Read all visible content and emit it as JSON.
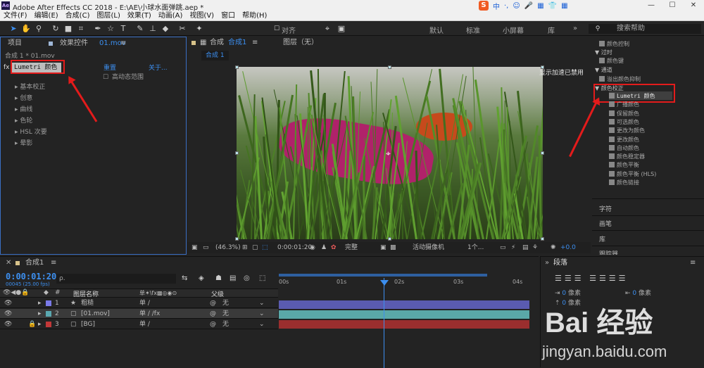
{
  "window": {
    "title": "Adobe After Effects CC 2018 - E:\\AE\\小球水面弹跳.aep *",
    "logo": "Ae",
    "controls": [
      "—",
      "☐",
      "✕"
    ]
  },
  "ime": {
    "brand": "S",
    "mode": "中",
    "icons": [
      "·,",
      "☺",
      "🎤",
      "▦",
      "👕",
      "▦"
    ]
  },
  "menu": [
    "文件(F)",
    "编辑(E)",
    "合成(C)",
    "图层(L)",
    "效果(T)",
    "动画(A)",
    "视图(V)",
    "窗口",
    "帮助(H)"
  ],
  "toolbar": {
    "snap_label": "对齐",
    "workspaces": [
      "默认",
      "标准",
      "小屏幕",
      "库"
    ],
    "more": "»",
    "search_placeholder": "搜索帮助"
  },
  "left_panel": {
    "tab_project": "项目",
    "tab_effects": "效果控件",
    "tab_effects_file": "01.mov",
    "menu": "≡",
    "breadcrumb": "合成 1 * 01.mov",
    "effect_fx": "fx",
    "effect_name": "Lumetri 颜色",
    "reset": "重置",
    "about": "关于...",
    "checkbox_label": "高动态范围",
    "sections": [
      "基本校正",
      "创意",
      "曲线",
      "色轮",
      "HSL 次要",
      "晕影"
    ]
  },
  "viewer": {
    "tab_comp": "合成",
    "tab_comp_name": "合成1",
    "menu": "≡",
    "tab_layer": "图层（无）",
    "subtab": "合成 1",
    "gpu_notice": "显示加速已禁用",
    "zoom": "(46.3%)",
    "timecode": "0:00:01:20",
    "quality": "完整",
    "camera": "活动摄像机",
    "views": "1个...",
    "exposure": "+0.0"
  },
  "right_panel": {
    "groups": [
      {
        "label": "过时",
        "items": [
          "颜色控制",
          "颜色键"
        ]
      },
      {
        "label": "通道",
        "items": [
          "溢出颜色抑制"
        ]
      }
    ],
    "color_group": "颜色校正",
    "color_items": [
      "Lumetri 颜色",
      "广播颜色",
      "保留颜色",
      "可选颜色",
      "更改为颜色",
      "更改颜色",
      "自动颜色",
      "颜色稳定器",
      "颜色平衡",
      "颜色平衡 (HLS)",
      "颜色链接"
    ],
    "sections": [
      "字符",
      "画笔",
      "库",
      "跟踪器"
    ]
  },
  "timeline": {
    "tab": "合成1",
    "menu": "≡",
    "timecode": "0:00:01:20",
    "frames": "00045 (25.00 fps)",
    "search_placeholder": "ρ.",
    "col_name": "图层名称",
    "col_parent": "父级",
    "ruler": [
      "00s",
      "01s",
      "02s",
      "03s",
      "04s"
    ],
    "playhead_seconds": 1.8,
    "layers": [
      {
        "num": "1",
        "name": "粗糙",
        "parent": "无",
        "color": "#7a7ae8"
      },
      {
        "num": "2",
        "name": "[01.mov]",
        "parent": "无",
        "color": "#5aa8b0"
      },
      {
        "num": "3",
        "name": "[BG]",
        "parent": "无",
        "color": "#c23838"
      }
    ]
  },
  "paragraph": {
    "title": "段落",
    "menu": "≡",
    "px_unit": "像素",
    "value": "0"
  },
  "watermark": {
    "brand": "Bai 经验",
    "url": "jingyan.baidu.com"
  }
}
